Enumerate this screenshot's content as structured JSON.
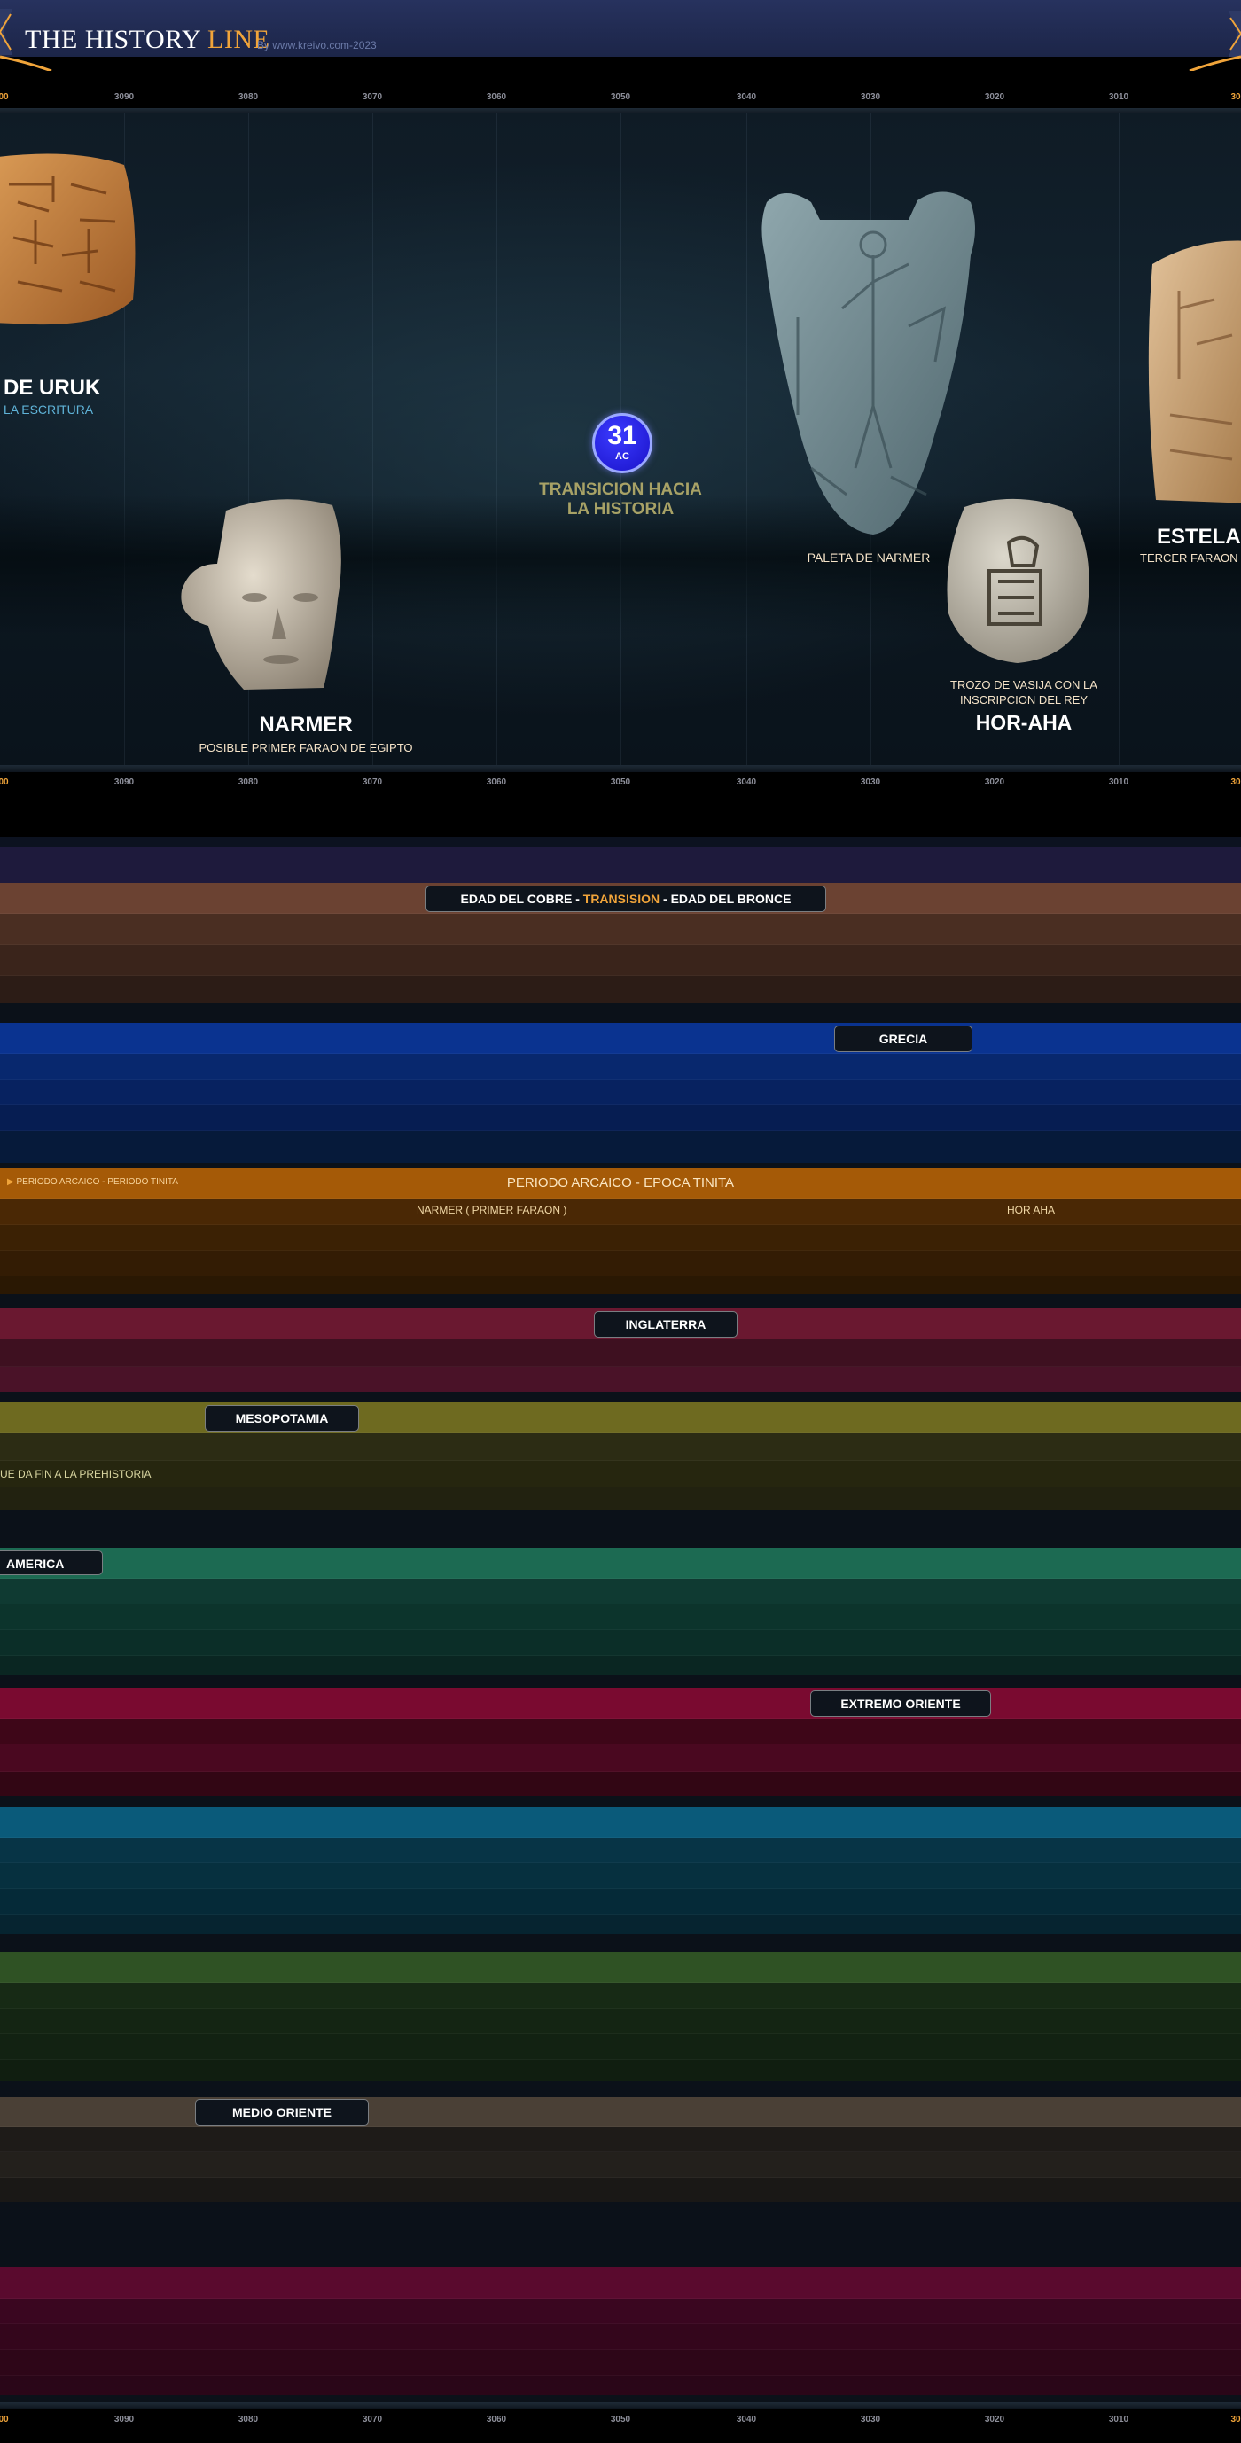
{
  "header": {
    "logo_main": "THE HISTORY ",
    "logo_accent": "LINE",
    "byline": "By www.kreivo.com-2023"
  },
  "ruler": {
    "ticks": [
      "00",
      "3090",
      "3080",
      "3070",
      "3060",
      "3050",
      "3040",
      "3030",
      "3020",
      "3010",
      "30"
    ]
  },
  "stage": {
    "uruk": {
      "title": "DE URUK",
      "subtitle": "LA ESCRITURA"
    },
    "century": {
      "number": "31",
      "suffix": "AC"
    },
    "transition": {
      "line1": "TRANSICION HACIA",
      "line2": "LA HISTORIA"
    },
    "narmer": {
      "title": "NARMER",
      "subtitle": "POSIBLE PRIMER FARAON DE EGIPTO"
    },
    "paleta": {
      "label": "PALETA DE NARMER"
    },
    "vasija": {
      "line1": "TROZO DE VASIJA CON LA",
      "line2": "INSCRIPCION DEL REY",
      "title": "HOR-AHA"
    },
    "estela": {
      "title": "ESTELA D",
      "subtitle": "TERCER FARAON D"
    }
  },
  "bands": {
    "edad": {
      "part1": "EDAD DEL COBRE",
      "sep": " - ",
      "part2": "TRANSISION",
      "part3": "EDAD DEL BRONCE"
    },
    "grecia": "GRECIA",
    "egipto": {
      "toggle": "PERIODO ARCAICO - PERIODO TINITA",
      "title": "PERIODO ARCAICO  -  EPOCA TINITA",
      "narmer": "NARMER ( PRIMER FARAON )",
      "horaha": "HOR AHA"
    },
    "inglaterra": "INGLATERRA",
    "mesopotamia": {
      "label": "MESOPOTAMIA",
      "note": "UE DA FIN A LA PREHISTORIA"
    },
    "america": "AMERICA",
    "extremo": "EXTREMO ORIENTE",
    "medio": "MEDIO ORIENTE"
  },
  "colors": {
    "accent": "#f0a43a",
    "header": "#27325e"
  }
}
